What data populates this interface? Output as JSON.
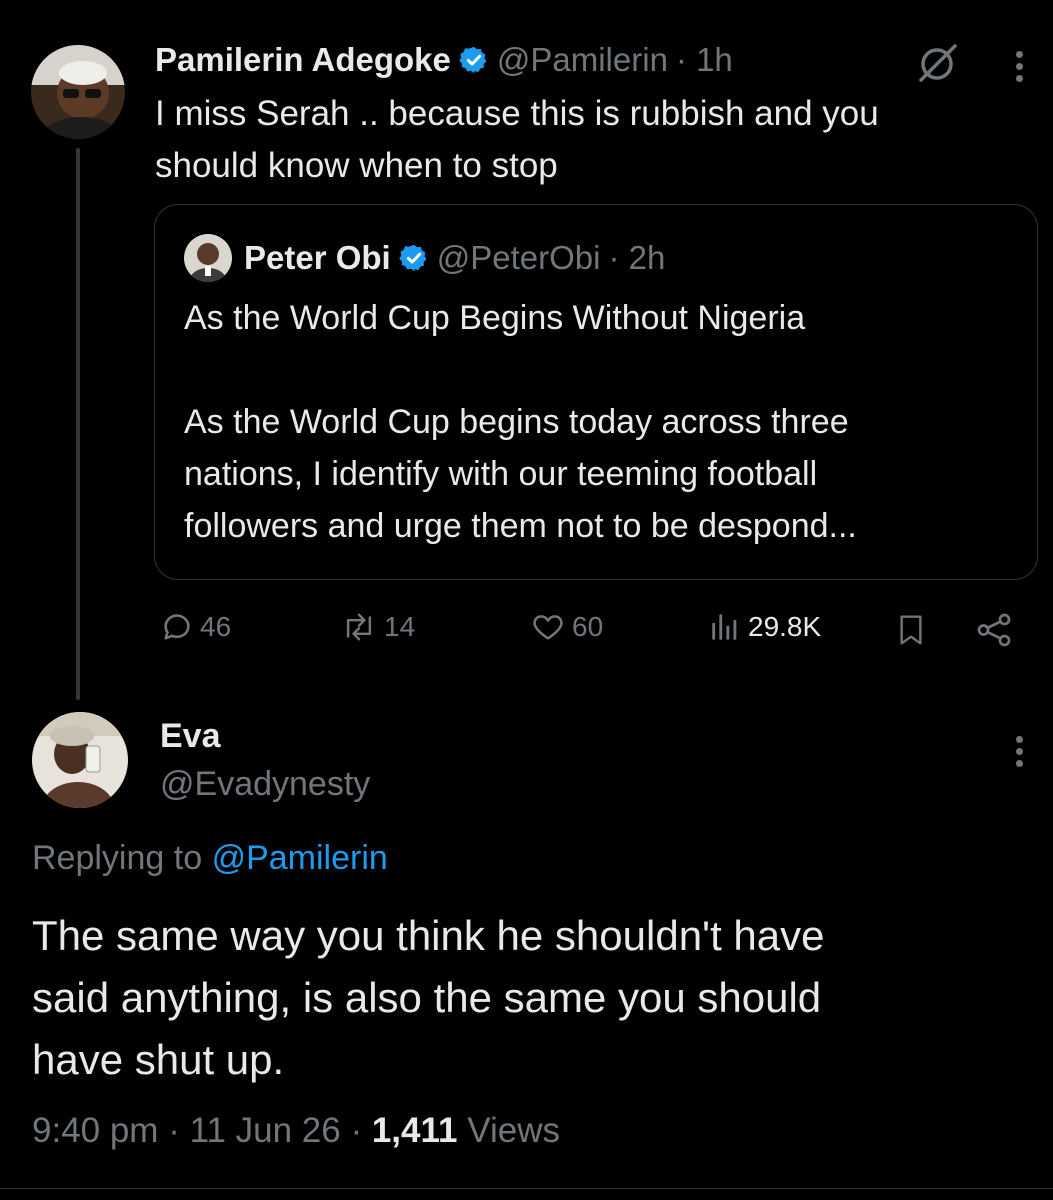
{
  "parent_tweet": {
    "author_name": "Pamilerin Adegoke",
    "handle": "@Pamilerin",
    "time": "· 1h",
    "text_line1": "I miss Serah .. because this is rubbish and you",
    "text_line2": "should know when to stop",
    "quoted": {
      "author_name": "Peter Obi",
      "handle": "@PeterObi",
      "time": "· 2h",
      "title": "As the World Cup Begins Without Nigeria",
      "body_line1": "As the World Cup begins today across three",
      "body_line2": "nations, I identify with our teeming football",
      "body_line3": "followers and urge them not to be despond..."
    },
    "stats": {
      "replies": "46",
      "reposts": "14",
      "likes": "60",
      "views": "29.8K"
    }
  },
  "reply_tweet": {
    "author_name": "Eva",
    "handle": "@Evadynesty",
    "replying_prefix": "Replying to",
    "replying_handle": "@Pamilerin",
    "text_line1": "The same way you think he shouldn't have",
    "text_line2": "said anything, is also the same you should",
    "text_line3": "have shut up.",
    "time": "9:40 pm",
    "date": "· 11 Jun 26 ·",
    "views_count": "1,411",
    "views_label": "Views"
  },
  "colors": {
    "background": "#000000",
    "text": "#e7e9ea",
    "muted": "#71767b",
    "accent": "#1d9bf0",
    "border": "#2f3336"
  },
  "icons": [
    "verified-badge-icon",
    "grok-icon",
    "more-icon",
    "reply-icon",
    "repost-icon",
    "like-icon",
    "views-icon",
    "bookmark-icon",
    "share-icon"
  ]
}
